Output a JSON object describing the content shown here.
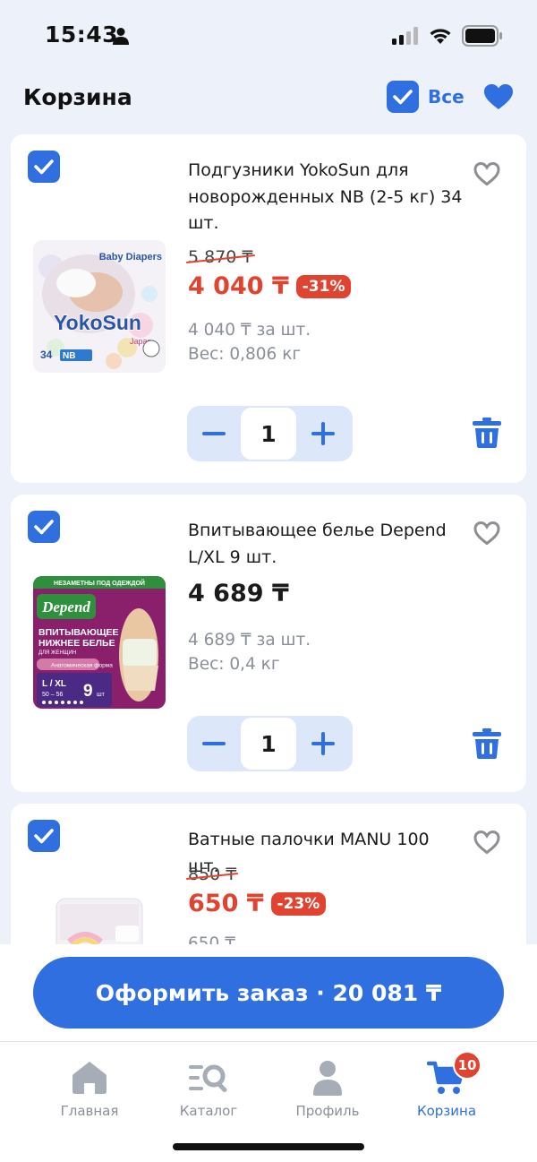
{
  "status_bar": {
    "time": "15:43"
  },
  "header": {
    "title": "Корзина",
    "select_all_label": "Все"
  },
  "items": [
    {
      "name": "Подгузники YokoSun для новорожденных NB (2-5 кг) 34 шт.",
      "old_price": "5 870 ₸",
      "price": "4 040 ₸",
      "discount": "-31%",
      "unit_price": "4 040 ₸ за шт.",
      "weight": "Вес: 0,806 кг",
      "quantity": "1",
      "image": {
        "brand": "YokoSun",
        "tag": "Baby Diapers",
        "count": "34",
        "size": "NB",
        "origin": "Japan"
      }
    },
    {
      "name": "Впитывающее белье Depend L/XL 9 шт.",
      "price": "4 689 ₸",
      "unit_price": "4 689 ₸ за шт.",
      "weight": "Вес: 0,4 кг",
      "quantity": "1",
      "image": {
        "banner": "НЕЗАМЕТНЫ ПОД ОДЕЖДОЙ",
        "brand": "Depend",
        "line1": "ВПИТЫВАЮЩЕЕ",
        "line2": "НИЖНЕЕ БЕЛЬЕ",
        "line3": "ДЛЯ ЖЕНЩИН",
        "feature": "Анатомическая форма",
        "size": "L / XL",
        "size_range": "50 – 56",
        "count": "9",
        "count_unit": "шт"
      }
    },
    {
      "name": "Ватные палочки MANU 100 шт.",
      "old_price": "850 ₸",
      "price": "650 ₸",
      "discount": "-23%",
      "unit_price": "650 ₸"
    }
  ],
  "checkout": {
    "label": "Оформить заказ · 20 081 ₸"
  },
  "tabs": [
    {
      "label": "Главная",
      "icon": "home-icon"
    },
    {
      "label": "Каталог",
      "icon": "catalog-search-icon"
    },
    {
      "label": "Профиль",
      "icon": "profile-icon"
    },
    {
      "label": "Корзина",
      "icon": "cart-icon",
      "badge": "10"
    }
  ],
  "colors": {
    "accent": "#2f6fe0",
    "sale": "#e0432f",
    "background": "#edf2fa"
  }
}
